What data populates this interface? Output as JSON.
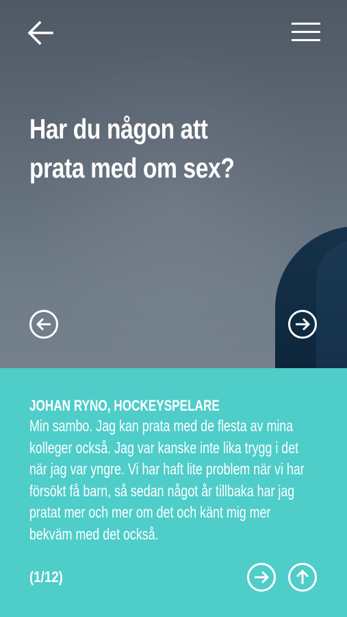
{
  "hero": {
    "title": "Har du någon att prata med om sex?",
    "icons": {
      "back": "arrow-left-icon",
      "menu": "hamburger-menu-icon",
      "prev": "circle-arrow-left-icon",
      "next": "circle-arrow-right-icon"
    }
  },
  "answer": {
    "author": "JOHAN RYNO, HOCKEYSPELARE",
    "quote": "Min sambo. Jag kan prata med de flesta av mina kolleger också. Jag var kanske inte lika trygg i det när jag var yngre. Vi har haft lite problem när vi har försökt få barn, så sedan något år tillbaka har jag pratat mer och mer om det och känt mig mer bekväm med det också.",
    "counter": "(1/12)",
    "icons": {
      "next": "circle-arrow-right-icon",
      "up": "circle-arrow-up-icon"
    }
  },
  "colors": {
    "panel": "#4ecdc9",
    "hero_bg": "#616c79",
    "text": "#ffffff"
  }
}
